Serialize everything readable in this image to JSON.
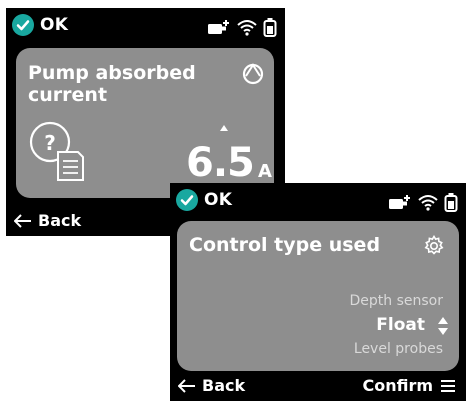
{
  "screen1": {
    "status": {
      "ok_label": "OK"
    },
    "title": "Pump absorbed current",
    "value": "6.5",
    "unit": "A",
    "back_label": "Back",
    "icons": [
      "check-circle-icon",
      "power-plug-icon",
      "wifi-icon",
      "battery-icon",
      "circle-progress-icon",
      "help-document-icon",
      "caret-up-icon",
      "back-arrow-icon"
    ]
  },
  "screen2": {
    "status": {
      "ok_label": "OK"
    },
    "title": "Control type used",
    "options": {
      "above": "Depth sensor",
      "selected": "Float",
      "below": "Level probes"
    },
    "back_label": "Back",
    "confirm_label": "Confirm",
    "icons": [
      "check-circle-icon",
      "power-plug-icon",
      "wifi-icon",
      "battery-icon",
      "settings-gear-icon",
      "up-down-arrows-icon",
      "back-arrow-icon",
      "menu-icon"
    ]
  },
  "colors": {
    "accent": "#19a8a0",
    "card": "#8e8e8e",
    "screen_bg": "#000000"
  }
}
